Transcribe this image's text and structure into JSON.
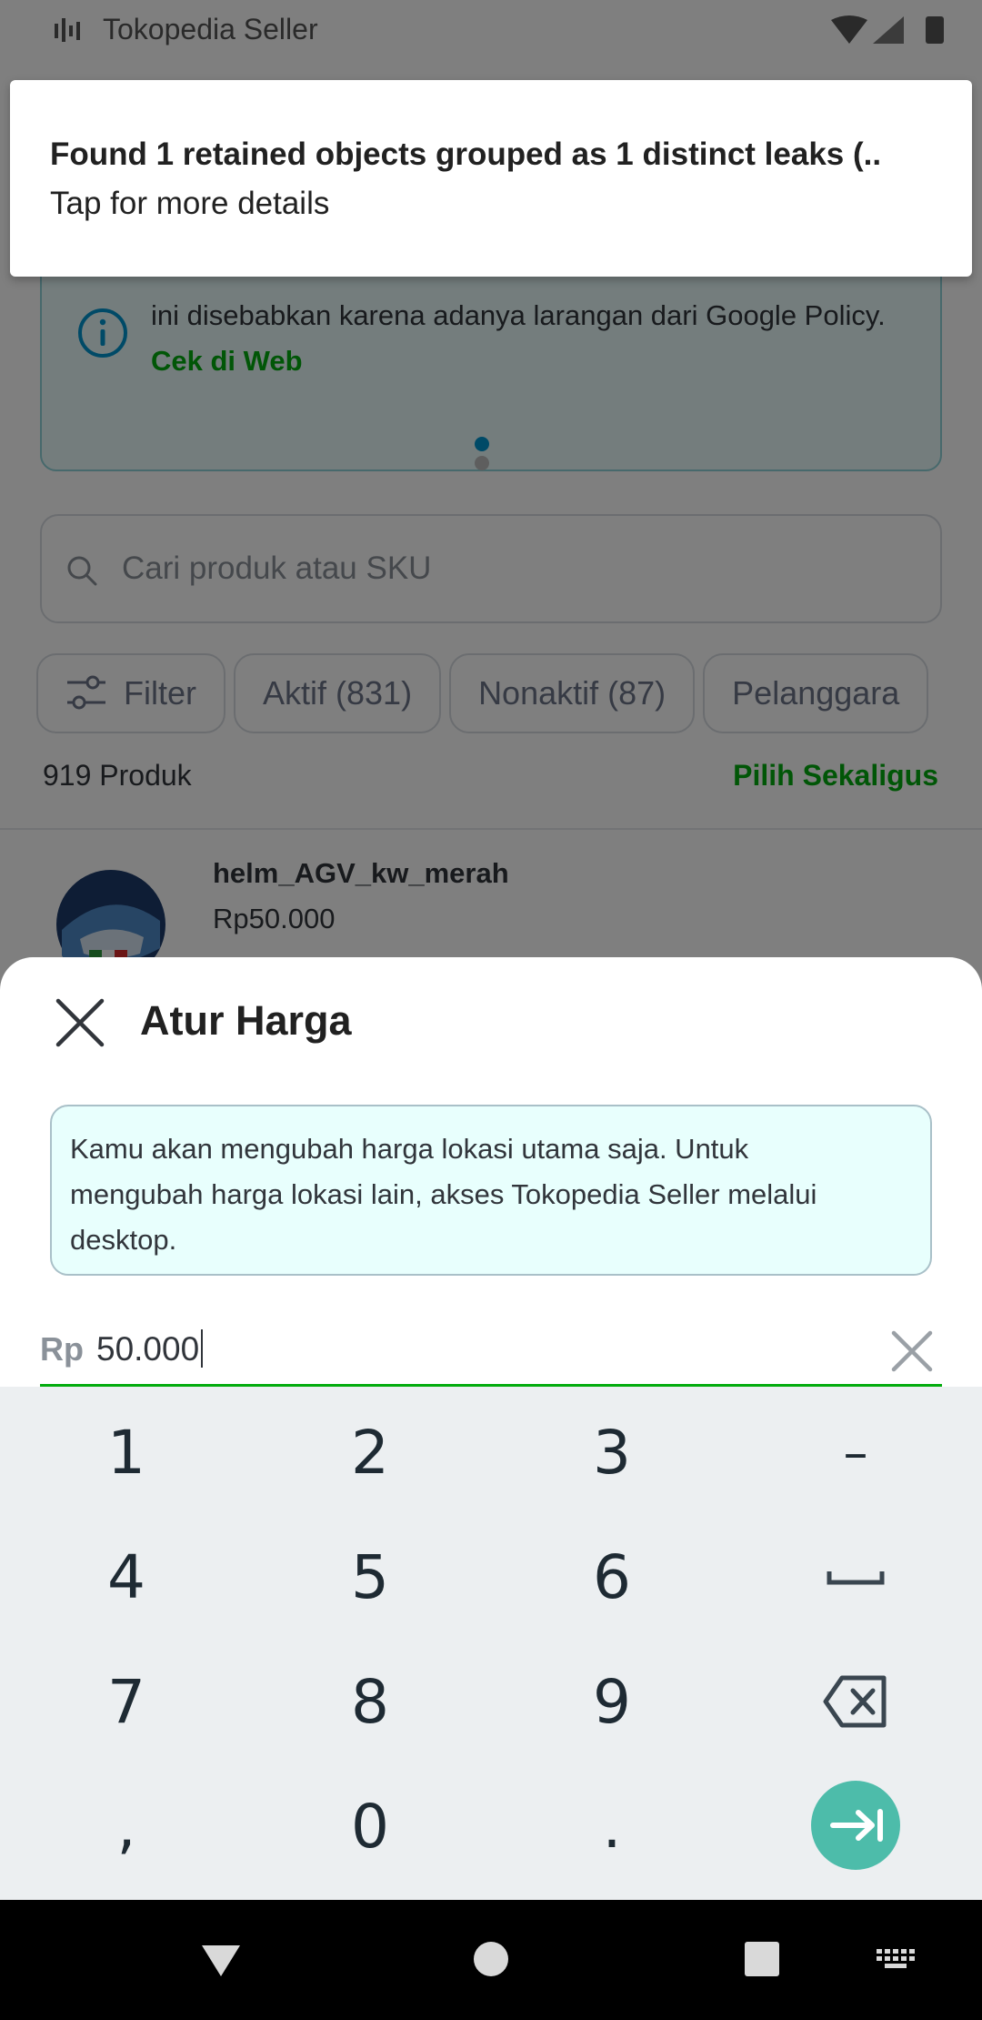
{
  "status_bar": {
    "app_title": "Tokopedia Seller"
  },
  "background": {
    "info_card": {
      "text": "ini disebabkan karena adanya larangan dari Google Policy.",
      "link": "Cek di Web"
    },
    "search": {
      "placeholder": "Cari produk atau SKU"
    },
    "chips": [
      {
        "label": "Filter"
      },
      {
        "label": "Aktif (831)"
      },
      {
        "label": "Nonaktif (87)"
      },
      {
        "label": "Pelanggara"
      }
    ],
    "product_count": "919 Produk",
    "select_all": "Pilih Sekaligus",
    "product": {
      "name": "helm_AGV_kw_merah",
      "price": "Rp50.000"
    }
  },
  "notification": {
    "title": "Found 1 retained objects grouped as 1 distinct leaks (..",
    "subtitle": "Tap for more details"
  },
  "sheet": {
    "title": "Atur Harga",
    "notice": "Kamu akan mengubah harga lokasi utama saja. Untuk mengubah harga lokasi lain, akses Tokopedia Seller melalui desktop.",
    "price_prefix": "Rp",
    "price_value": "50.000"
  },
  "keyboard": {
    "row1": [
      "1",
      "2",
      "3",
      "–"
    ],
    "row2": [
      "4",
      "5",
      "6"
    ],
    "row3": [
      "7",
      "8",
      "9"
    ],
    "row4": [
      ",",
      "0",
      "."
    ]
  },
  "colors": {
    "accent_green": "#03ac0e",
    "enter_key": "#4dbcaa",
    "notice_bg": "#e8fffd"
  }
}
